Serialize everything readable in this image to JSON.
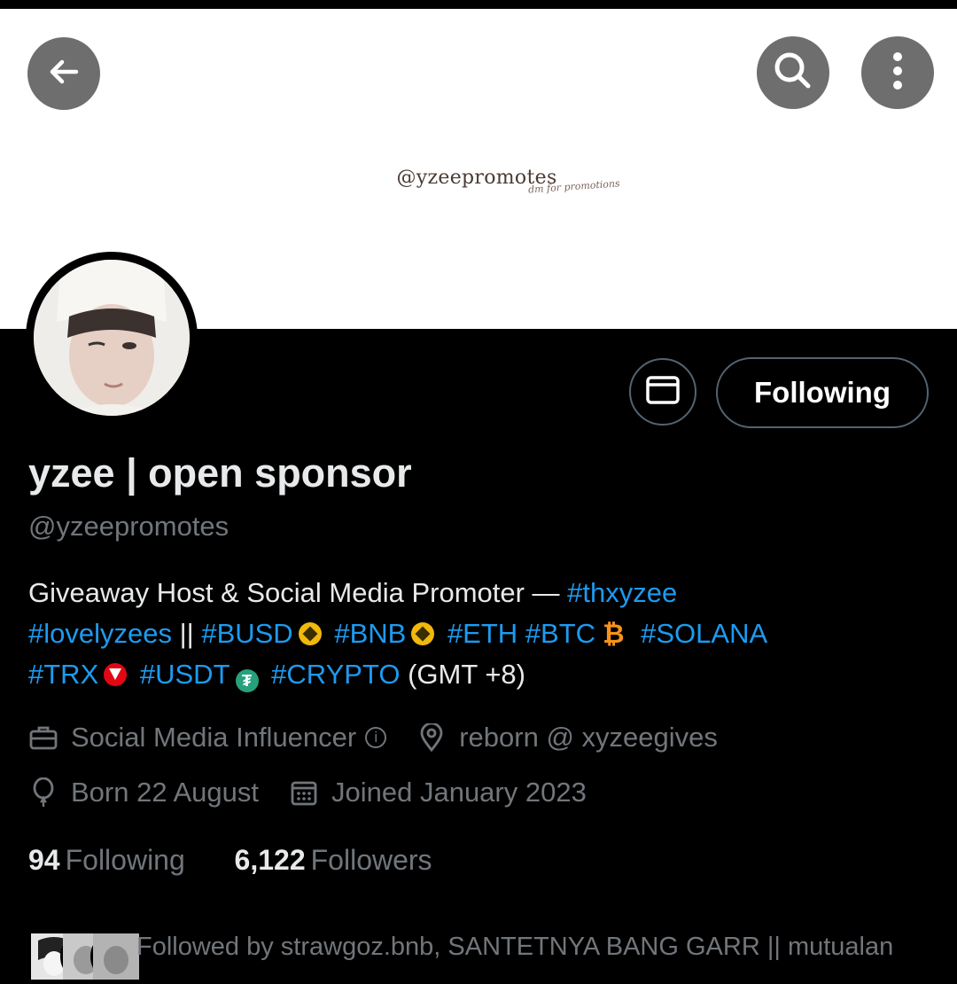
{
  "header": {
    "back_icon": "arrow-left-icon",
    "search_icon": "search-icon",
    "more_icon": "more-vertical-icon"
  },
  "banner": {
    "handle": "@yzeepromotes",
    "tagline": "dm for promotions"
  },
  "actions": {
    "message_icon": "mail-icon",
    "follow_label": "Following"
  },
  "profile": {
    "name": "yzee | open sponsor",
    "handle": "@yzeepromotes"
  },
  "bio": {
    "intro": "Giveaway Host & Social Media Promoter — ",
    "tag_thxyzee": "#thxyzee",
    "tag_lovelyzees": "#lovelyzees",
    "separator": " || ",
    "tag_busd": "#BUSD",
    "tag_bnb": "#BNB",
    "tag_eth": "#ETH",
    "tag_btc": "#BTC",
    "btc_symbol": "₿",
    "tag_solana": "#SOLANA",
    "tag_trx": "#TRX",
    "tag_usdt": "#USDT",
    "usdt_symbol": "₮",
    "tag_crypto": "#CRYPTO",
    "timezone": " (GMT +8)"
  },
  "meta": {
    "category": "Social Media Influencer",
    "location": "reborn @ xyzeegives",
    "birthday": "Born 22 August",
    "joined": "Joined January 2023"
  },
  "stats": {
    "following_count": "94",
    "following_label": "Following",
    "followers_count": "6,122",
    "followers_label": "Followers"
  },
  "followed_by": {
    "text": "Followed by strawgoz.bnb, SANTETNYA BANG GARR || mutualan"
  },
  "colors": {
    "accent": "#1d9bf0",
    "muted": "#71767b",
    "background": "#000000"
  }
}
